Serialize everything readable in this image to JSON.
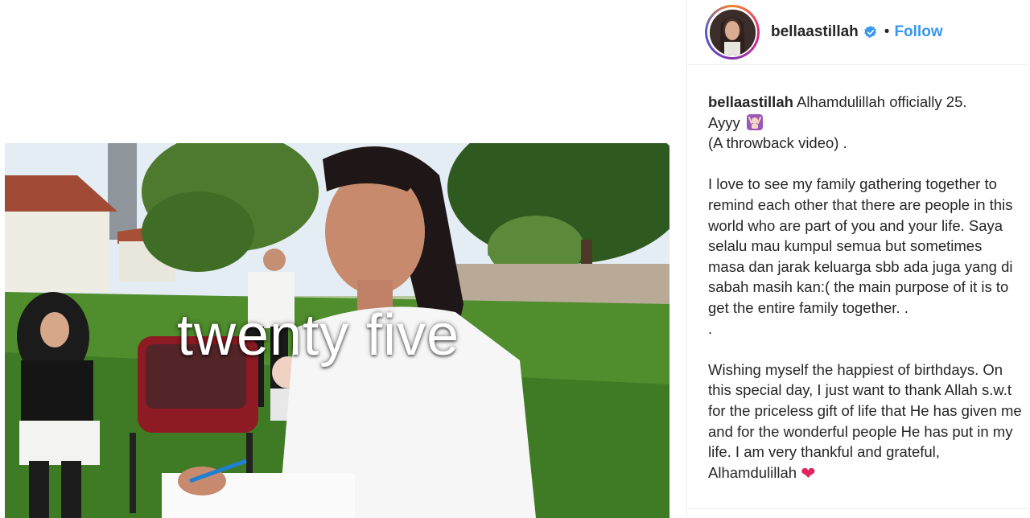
{
  "post": {
    "overlay_text": "twenty five"
  },
  "header": {
    "username": "bellaastillah",
    "separator": "•",
    "follow_label": "Follow",
    "verified_icon": "verified-badge-icon"
  },
  "caption": {
    "username": "bellaastillah",
    "lines": [
      "Alhamdulillah officially 25.",
      "Ayyy",
      "(A throwback video) .",
      "I love to see my family gathering together to remind each other that there are people in this world who are part of you and your life. Saya selalu mau kumpul semua but sometimes masa dan jarak keluarga sbb ada juga yang di sabah masih kan:( the main purpose of it is to get the entire family together. .",
      ".",
      "Wishing myself the happiest of birthdays. On this special day, I just want to thank Allah s.w.t for the priceless gift of life that He has given me and for the wonderful people He has put in my life. I am very thankful and grateful, Alhamdulillah"
    ],
    "emoji_after_ayyy": "person-raising-hands-emoji",
    "emoji_end": "red-heart-emoji"
  },
  "colors": {
    "follow": "#3897f0",
    "verified": "#3897f0",
    "heart": "#e0245e",
    "border": "#efefef"
  }
}
